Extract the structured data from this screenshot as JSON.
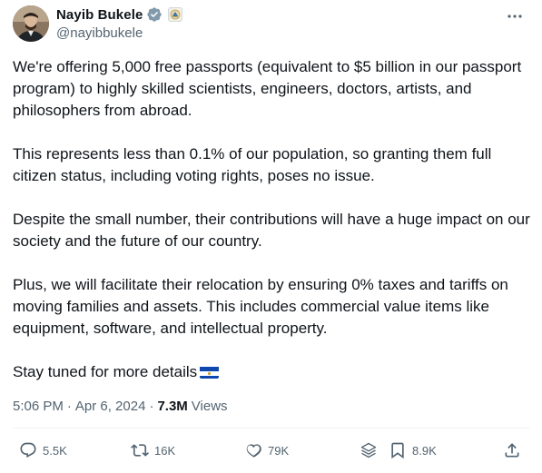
{
  "author": {
    "display_name": "Nayib Bukele",
    "handle": "@nayibbukele",
    "verified_icon": "verified-badge-icon",
    "affiliate_icon": "government-seal-icon"
  },
  "post": {
    "paragraphs": [
      "We're offering 5,000 free passports (equivalent to $5 billion in our passport program) to highly skilled scientists, engineers, doctors, artists, and philosophers from abroad.",
      "This represents less than 0.1% of our population, so granting them full citizen status, including voting rights, poses no issue.",
      "Despite the small number, their contributions will have a huge impact on our society and the future of our country.",
      "Plus, we will facilitate their relocation by ensuring 0% taxes and tariffs on moving families and assets. This includes commercial value items like equipment, software, and intellectual property.",
      "Stay tuned for more details"
    ],
    "emoji_flag": "el-salvador-flag"
  },
  "meta": {
    "time": "5:06 PM",
    "separator": "·",
    "date": "Apr 6, 2024",
    "views_count": "7.3M",
    "views_label": "Views"
  },
  "actions": {
    "replies": "5.5K",
    "reposts": "16K",
    "likes": "79K",
    "bookmarks": "8.9K"
  },
  "colors": {
    "text": "#0f1419",
    "secondary": "#536471",
    "verified": "#1d9bf0",
    "divider": "#eff3f4"
  }
}
